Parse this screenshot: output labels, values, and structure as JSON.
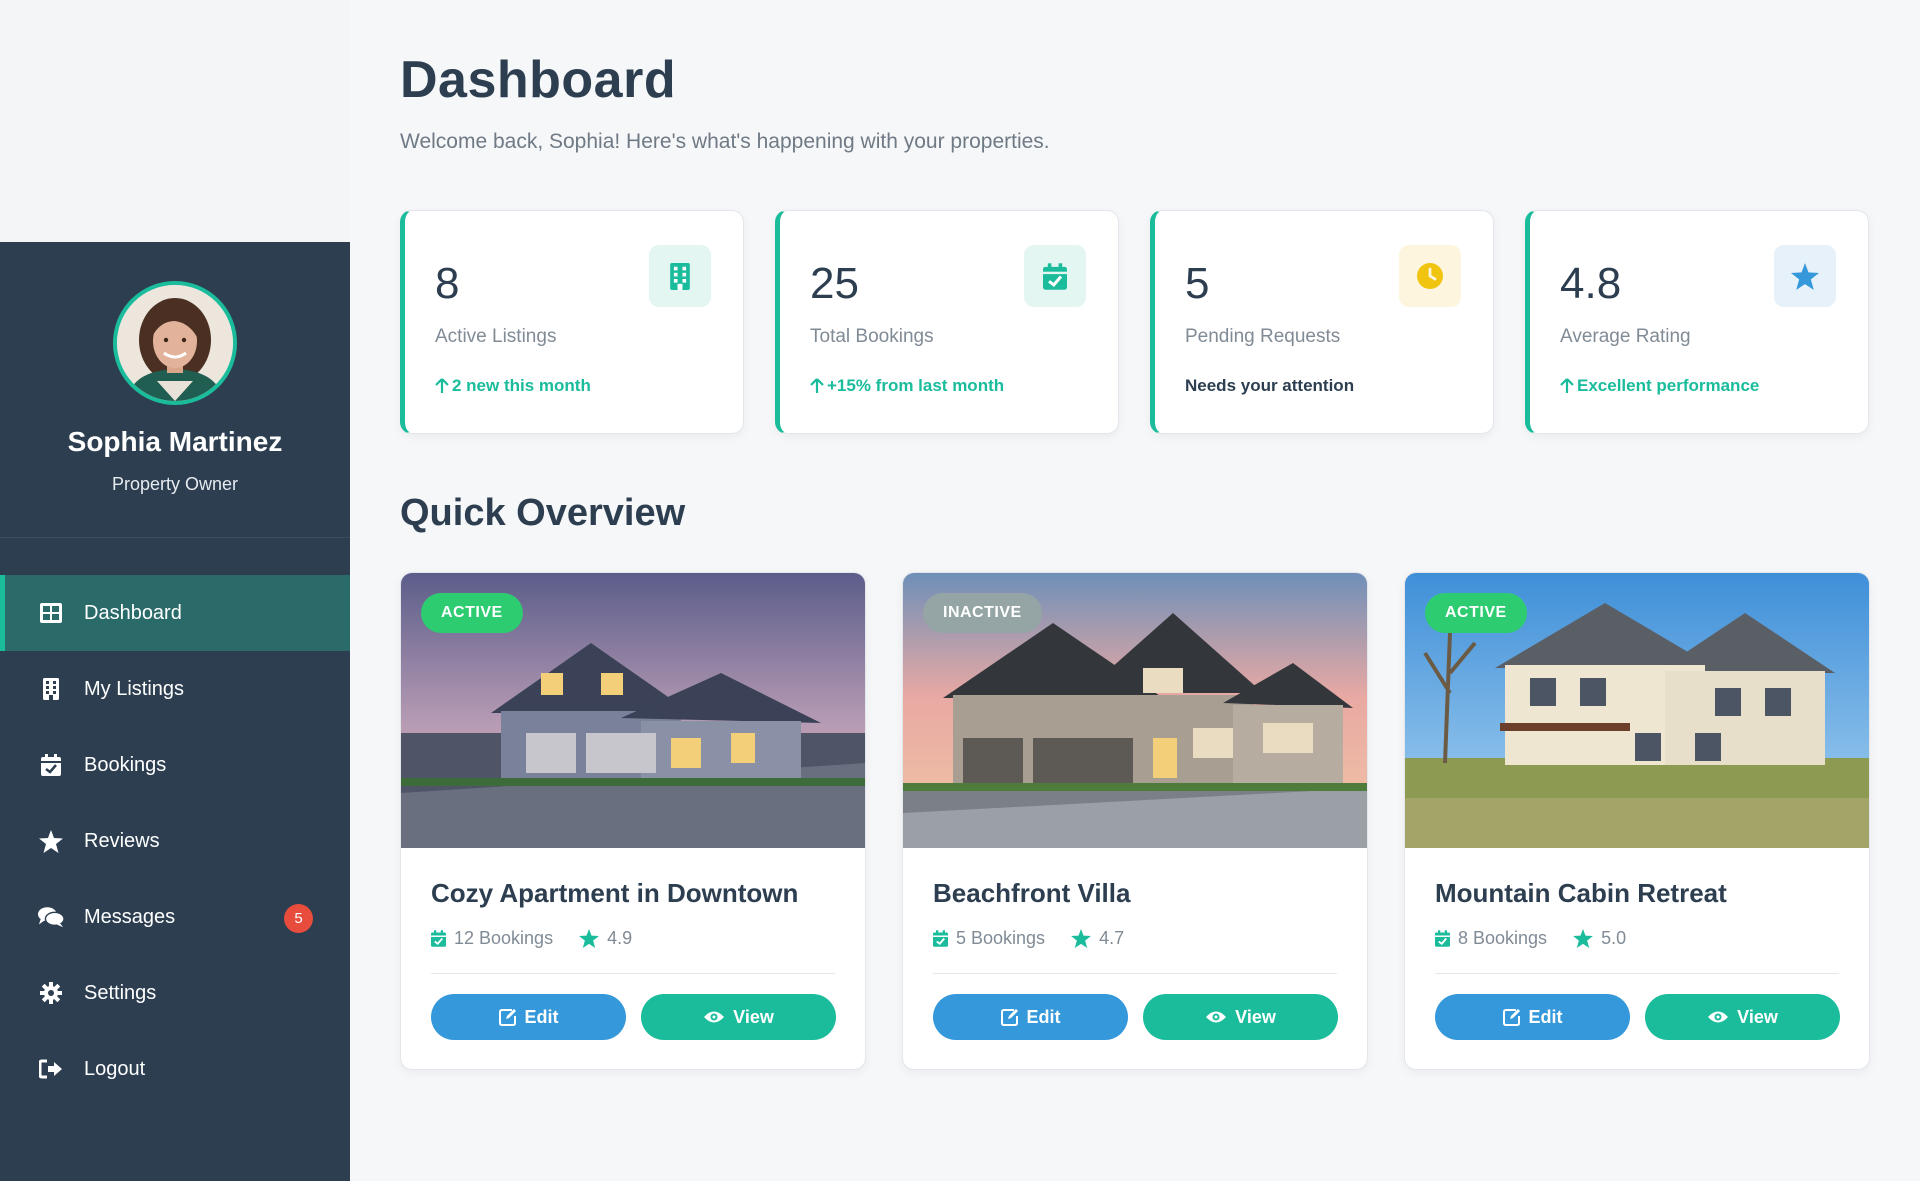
{
  "user": {
    "name": "Sophia Martinez",
    "role": "Property Owner"
  },
  "nav": {
    "items": [
      {
        "label": "Dashboard",
        "icon": "dashboard-icon",
        "active": true
      },
      {
        "label": "My Listings",
        "icon": "building-icon"
      },
      {
        "label": "Bookings",
        "icon": "calendar-check-icon"
      },
      {
        "label": "Reviews",
        "icon": "star-icon"
      },
      {
        "label": "Messages",
        "icon": "comments-icon",
        "badge": "5"
      },
      {
        "label": "Settings",
        "icon": "gear-icon"
      },
      {
        "label": "Logout",
        "icon": "logout-icon"
      }
    ]
  },
  "header": {
    "title": "Dashboard",
    "subtitle": "Welcome back, Sophia! Here's what's happening with your properties."
  },
  "stats": [
    {
      "value": "8",
      "label": "Active Listings",
      "note": "2 new this month",
      "icon": "building-icon",
      "icon_color": "#1abc9c",
      "icon_bg": "#e3f6f2"
    },
    {
      "value": "25",
      "label": "Total Bookings",
      "note": "+15% from last month",
      "icon": "calendar-check-icon",
      "icon_color": "#1abc9c",
      "icon_bg": "#e3f6f2"
    },
    {
      "value": "5",
      "label": "Pending Requests",
      "note": "Needs your attention",
      "icon": "clock-icon",
      "icon_color": "#f1c40f",
      "icon_bg": "#fdf5dd"
    },
    {
      "value": "4.8",
      "label": "Average Rating",
      "note": "Excellent performance",
      "icon": "star-icon",
      "icon_color": "#3498db",
      "icon_bg": "#e6f1fa"
    }
  ],
  "overview": {
    "title": "Quick Overview",
    "properties": [
      {
        "status": "ACTIVE",
        "status_color": "#2ecc71",
        "title": "Cozy Apartment in Downtown",
        "bookings": "12 Bookings",
        "rating": "4.9"
      },
      {
        "status": "INACTIVE",
        "status_color": "#95a5a6",
        "title": "Beachfront Villa",
        "bookings": "5 Bookings",
        "rating": "4.7"
      },
      {
        "status": "ACTIVE",
        "status_color": "#2ecc71",
        "title": "Mountain Cabin Retreat",
        "bookings": "8 Bookings",
        "rating": "5.0"
      }
    ],
    "edit_label": "Edit",
    "view_label": "View"
  },
  "colors": {
    "sidebar": "#2c3e50",
    "accent": "#1abc9c",
    "primary": "#3498db",
    "danger": "#e74c3c"
  }
}
